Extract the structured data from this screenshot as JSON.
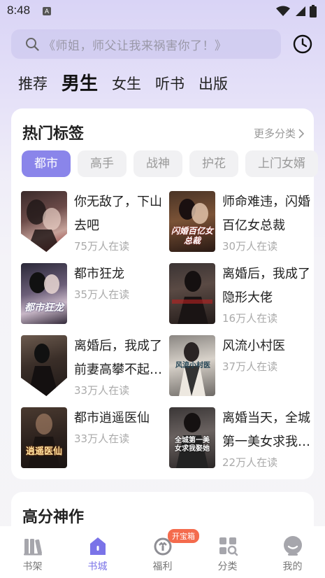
{
  "status_bar": {
    "time": "8:48",
    "notification_glyph": "A"
  },
  "search": {
    "placeholder": "《师姐，师父让我来祸害你了！》"
  },
  "category_tabs": [
    {
      "label": "推荐",
      "active": false
    },
    {
      "label": "男生",
      "active": true
    },
    {
      "label": "女生",
      "active": false
    },
    {
      "label": "听书",
      "active": false
    },
    {
      "label": "出版",
      "active": false
    }
  ],
  "hot_tags": {
    "title": "热门标签",
    "more_label": "更多分类",
    "tags": [
      {
        "label": "都市",
        "active": true
      },
      {
        "label": "高手",
        "active": false
      },
      {
        "label": "战神",
        "active": false
      },
      {
        "label": "护花",
        "active": false
      },
      {
        "label": "上门女婿",
        "active": false
      }
    ],
    "books": [
      {
        "title": "你无敌了，下山去吧",
        "readers": "75万人在读",
        "cover_text": ""
      },
      {
        "title": "师命难违，闪婚百亿女总裁",
        "readers": "30万人在读",
        "cover_text": "闪婚百亿女总裁"
      },
      {
        "title": "都市狂龙",
        "readers": "35万人在读",
        "cover_text": "都市狂龙"
      },
      {
        "title": "离婚后，我成了隐形大佬",
        "readers": "16万人在读",
        "cover_text": ""
      },
      {
        "title": "离婚后，我成了前妻高攀不起的人",
        "readers": "33万人在读",
        "cover_text": ""
      },
      {
        "title": "风流小村医",
        "readers": "37万人在读",
        "cover_text": "风流小村医"
      },
      {
        "title": "都市逍遥医仙",
        "readers": "33万人在读",
        "cover_text": "逍遥医仙"
      },
      {
        "title": "离婚当天，全城第一美女求我娶她",
        "readers": "22万人在读",
        "cover_text": "全城第一美女求我娶她"
      }
    ]
  },
  "section2": {
    "title": "高分神作"
  },
  "bottom_nav": [
    {
      "label": "书架",
      "icon": "bookshelf-icon",
      "active": false
    },
    {
      "label": "书城",
      "icon": "bookstore-icon",
      "active": true
    },
    {
      "label": "福利",
      "icon": "gift-icon",
      "active": false,
      "badge": "开宝箱"
    },
    {
      "label": "分类",
      "icon": "category-icon",
      "active": false
    },
    {
      "label": "我的",
      "icon": "profile-icon",
      "active": false
    }
  ],
  "colors": {
    "accent": "#8a85ea",
    "nav_active": "#7a73e8",
    "badge": "#f46b4d"
  }
}
